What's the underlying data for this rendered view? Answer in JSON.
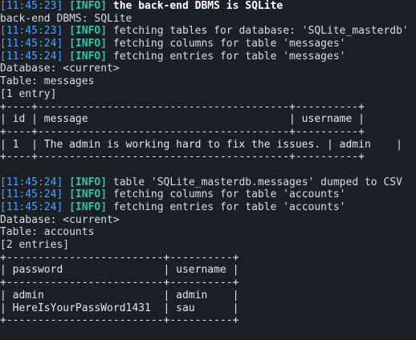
{
  "terminal": {
    "background": "#1c1f24",
    "timestamp_color": "#4da3ff",
    "info_color": "#32c4a8",
    "lines": [
      {
        "type": "log",
        "ts": "[11:45:23]",
        "lvl": "[INFO]",
        "msg": " the back-end DBMS is SQLite",
        "bold": true
      },
      {
        "type": "plain",
        "text": "back-end DBMS: SQLite"
      },
      {
        "type": "log",
        "ts": "[11:45:23]",
        "lvl": "[INFO]",
        "msg": " fetching tables for database: 'SQLite_masterdb'"
      },
      {
        "type": "log",
        "ts": "[11:45:24]",
        "lvl": "[INFO]",
        "msg": " fetching columns for table 'messages'"
      },
      {
        "type": "log",
        "ts": "[11:45:24]",
        "lvl": "[INFO]",
        "msg": " fetching entries for table 'messages'"
      },
      {
        "type": "plain",
        "text": "Database: <current>"
      },
      {
        "type": "plain",
        "text": "Table: messages"
      },
      {
        "type": "plain",
        "text": "[1 entry]"
      },
      {
        "type": "table",
        "text": "+----+----------------------------------------+----------+"
      },
      {
        "type": "table",
        "text": "| id | message                                | username |"
      },
      {
        "type": "table",
        "text": "+----+----------------------------------------+----------+"
      },
      {
        "type": "table",
        "text": "| 1  | The admin is working hard to fix the issues. | admin    |"
      },
      {
        "type": "table",
        "text": "+----+----------------------------------------+----------+"
      },
      {
        "type": "plain",
        "text": ""
      },
      {
        "type": "log",
        "ts": "[11:45:24]",
        "lvl": "[INFO]",
        "msg": " table 'SQLite_masterdb.messages' dumped to CSV"
      },
      {
        "type": "log",
        "ts": "[11:45:24]",
        "lvl": "[INFO]",
        "msg": " fetching columns for table 'accounts'"
      },
      {
        "type": "log",
        "ts": "[11:45:24]",
        "lvl": "[INFO]",
        "msg": " fetching entries for table 'accounts'"
      },
      {
        "type": "plain",
        "text": "Database: <current>"
      },
      {
        "type": "plain",
        "text": "Table: accounts"
      },
      {
        "type": "plain",
        "text": "[2 entries]"
      },
      {
        "type": "table",
        "text": "+-------------------------+----------+"
      },
      {
        "type": "table",
        "text": "| password                | username |"
      },
      {
        "type": "table",
        "text": "+-------------------------+----------+"
      },
      {
        "type": "table",
        "text": "| admin                   | admin    |"
      },
      {
        "type": "table",
        "text": "| HereIsYourPassWord1431  | sau      |"
      },
      {
        "type": "table",
        "text": "+-------------------------+----------+"
      }
    ]
  }
}
